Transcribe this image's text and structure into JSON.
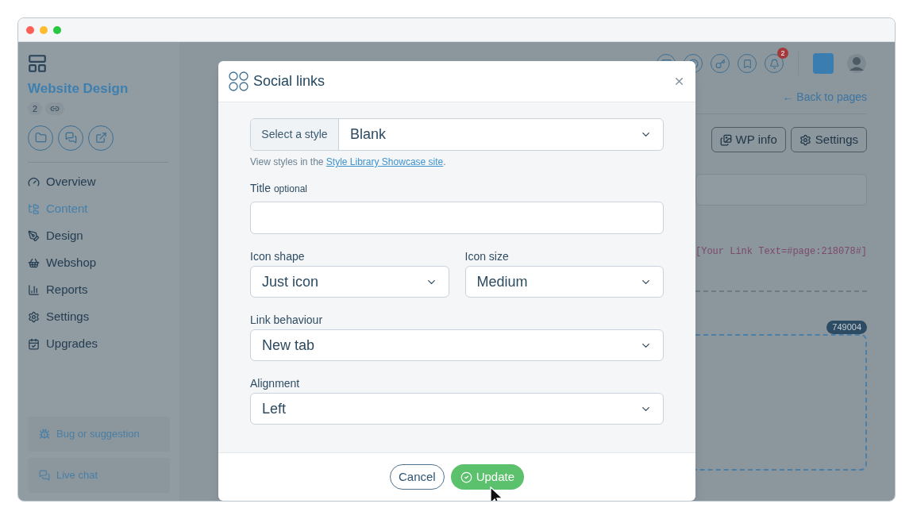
{
  "sidebar": {
    "title": "Website Design",
    "count": "2",
    "nav": [
      {
        "label": "Overview",
        "selected": false
      },
      {
        "label": "Content",
        "selected": true
      },
      {
        "label": "Design",
        "selected": false
      },
      {
        "label": "Webshop",
        "selected": false
      },
      {
        "label": "Reports",
        "selected": false
      },
      {
        "label": "Settings",
        "selected": false
      },
      {
        "label": "Upgrades",
        "selected": false
      }
    ],
    "footer_links": [
      "Bug or suggestion",
      "Live chat"
    ]
  },
  "topbar": {
    "notification_count": "2"
  },
  "page": {
    "back_link": "← Back to pages",
    "buttons": [
      "WP info",
      "Settings"
    ],
    "shortcode": "[Your Link Text=#page:218078#]",
    "block_id": "749004"
  },
  "modal": {
    "title": "Social links",
    "style_select": {
      "label": "Select a style",
      "value": "Blank"
    },
    "helper": {
      "text": "View styles in the",
      "link": "Style Library Showcase site",
      "suffix": "."
    },
    "title_field": {
      "label": "Title",
      "hint": "optional"
    },
    "rows": [
      {
        "fields": [
          {
            "label": "Icon shape",
            "value": "Just icon"
          },
          {
            "label": "Icon size",
            "value": "Medium"
          }
        ]
      },
      {
        "fields": [
          {
            "label": "Link behaviour",
            "value": "New tab"
          }
        ]
      },
      {
        "fields": [
          {
            "label": "Alignment",
            "value": "Left"
          }
        ]
      }
    ],
    "cancel": "Cancel",
    "update": "Update"
  }
}
